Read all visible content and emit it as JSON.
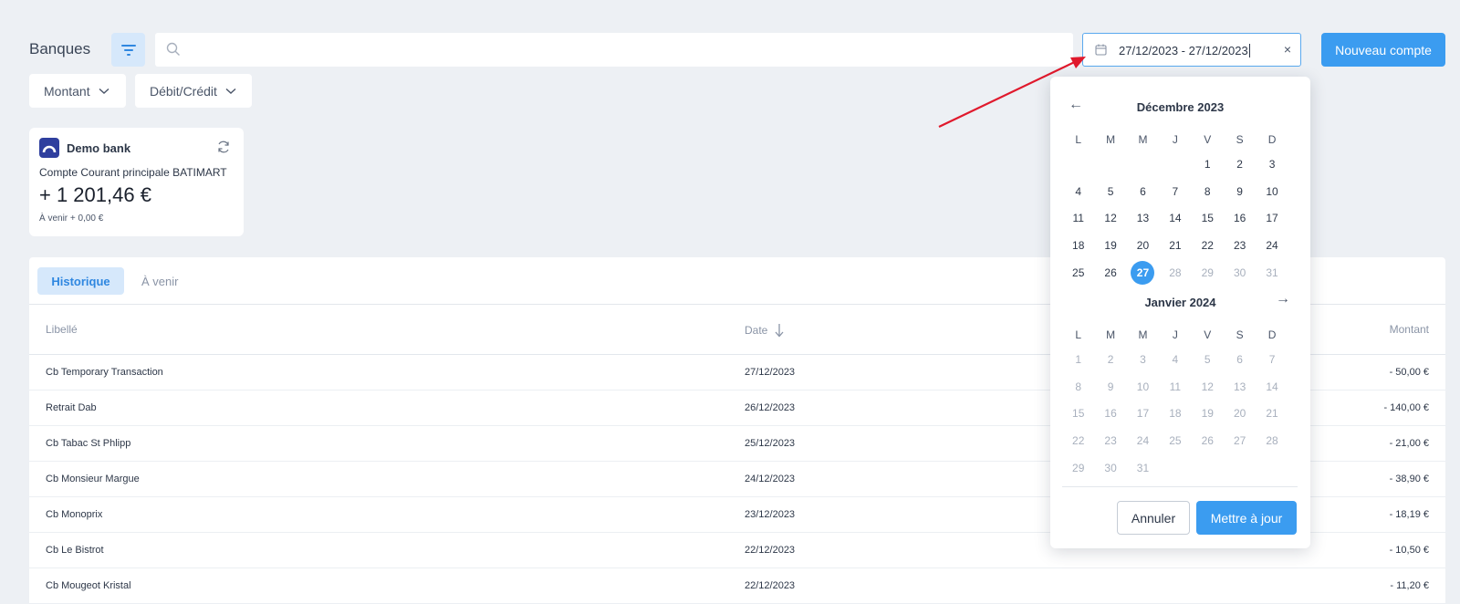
{
  "header": {
    "title": "Banques",
    "search_placeholder": "",
    "date_range": "27/12/2023 - 27/12/2023",
    "clear_symbol": "×",
    "new_account_label": "Nouveau compte"
  },
  "filters": [
    {
      "label": "Montant"
    },
    {
      "label": "Débit/Crédit"
    }
  ],
  "bank_card": {
    "bank_name": "Demo bank",
    "account_name": "Compte Courant principale BATIMART",
    "balance": "+ 1 201,46 €",
    "upcoming": "À venir + 0,00 €"
  },
  "tabs": [
    {
      "label": "Historique",
      "active": true
    },
    {
      "label": "À venir",
      "active": false
    }
  ],
  "table": {
    "columns": {
      "label": "Libellé",
      "date": "Date",
      "amount": "Montant"
    },
    "rows": [
      {
        "label": "Cb Temporary Transaction",
        "date": "27/12/2023",
        "amount": "- 50,00 €"
      },
      {
        "label": "Retrait Dab",
        "date": "26/12/2023",
        "amount": "- 140,00 €"
      },
      {
        "label": "Cb Tabac St Phlipp",
        "date": "25/12/2023",
        "amount": "- 21,00 €"
      },
      {
        "label": "Cb Monsieur Margue",
        "date": "24/12/2023",
        "amount": "- 38,90 €"
      },
      {
        "label": "Cb Monoprix",
        "date": "23/12/2023",
        "amount": "- 18,19 €"
      },
      {
        "label": "Cb Le Bistrot",
        "date": "22/12/2023",
        "amount": "- 10,50 €"
      },
      {
        "label": "Cb Mougeot Kristal",
        "date": "22/12/2023",
        "amount": "- 11,20 €"
      }
    ]
  },
  "datepicker": {
    "prev_symbol": "←",
    "next_symbol": "→",
    "weekdays": [
      "L",
      "M",
      "M",
      "J",
      "V",
      "S",
      "D"
    ],
    "months": [
      {
        "title": "Décembre 2023",
        "leading_blanks": 4,
        "days": 31,
        "selected": 27,
        "muted_after": 27
      },
      {
        "title": "Janvier 2024",
        "leading_blanks": 0,
        "days": 31,
        "selected": null,
        "muted_after": 0
      }
    ],
    "cancel_label": "Annuler",
    "update_label": "Mettre à jour"
  },
  "colors": {
    "accent": "#3b9cf0",
    "annotation_arrow": "#e0192c",
    "background": "#edf0f4"
  }
}
